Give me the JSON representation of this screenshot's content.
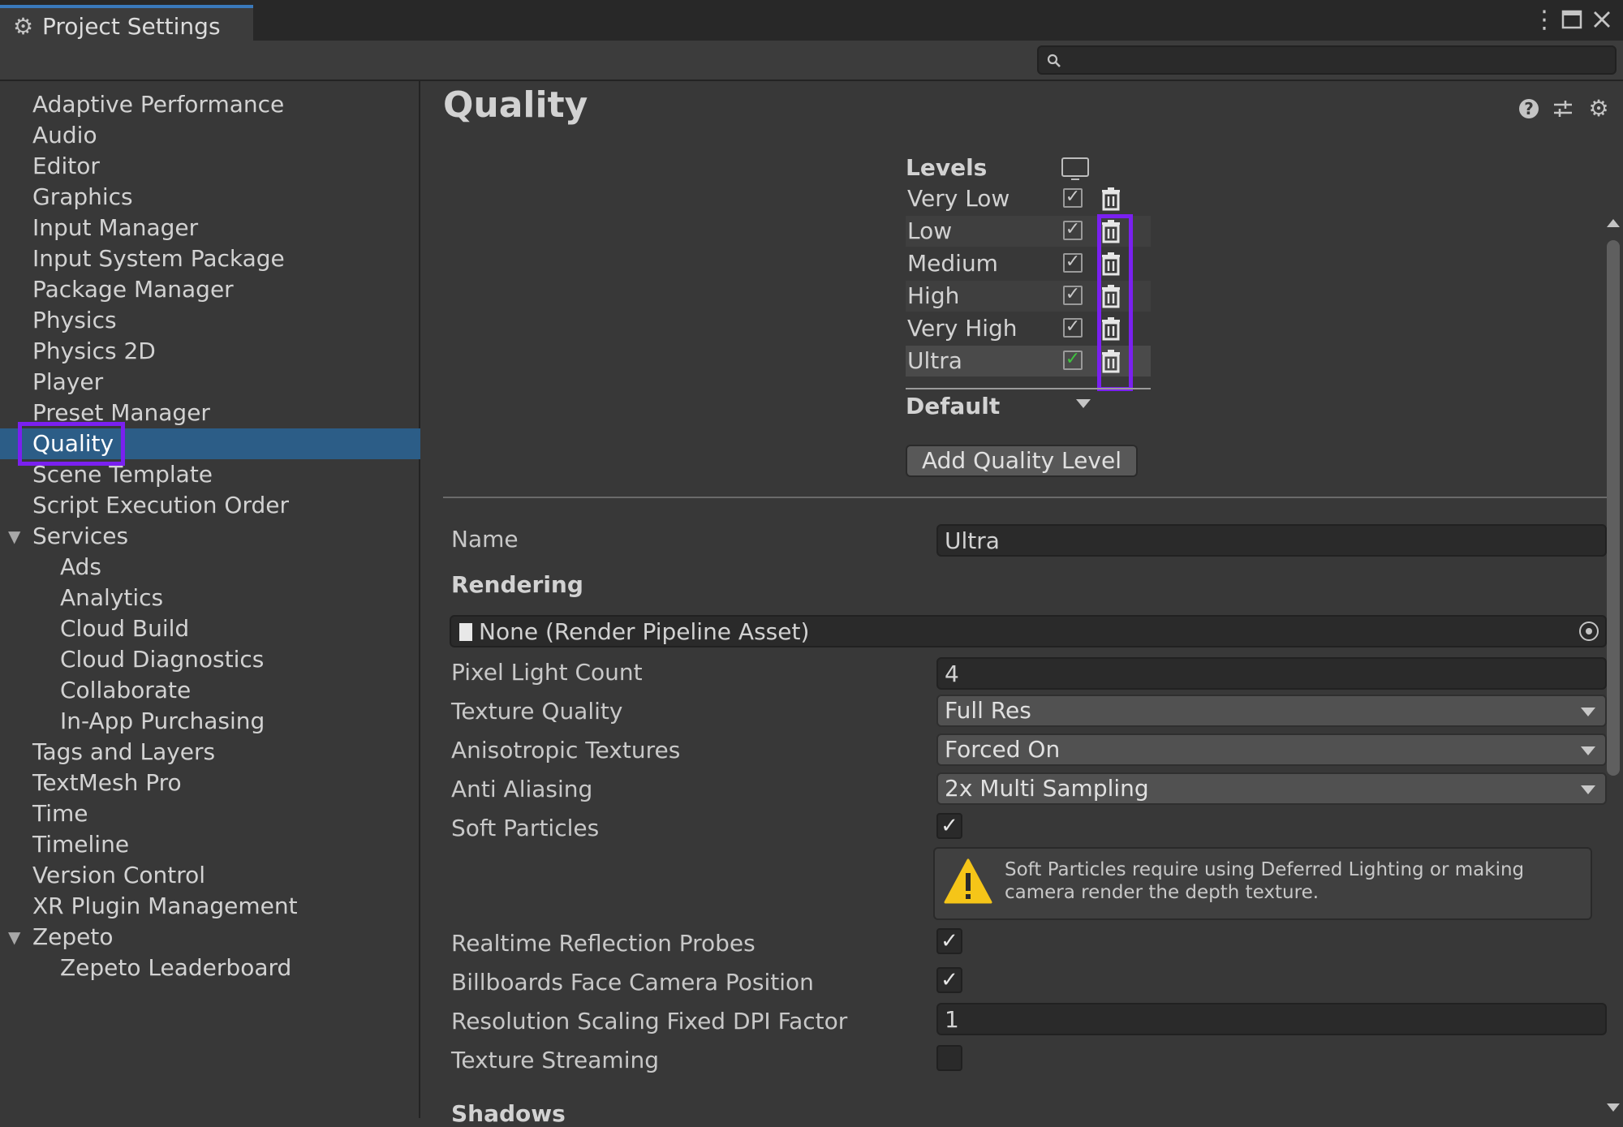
{
  "window": {
    "tab_title": "Project Settings",
    "gear_icon": "gear-icon",
    "controls": [
      "more-icon",
      "maximize-icon",
      "close-icon"
    ]
  },
  "search": {
    "placeholder": "",
    "value": ""
  },
  "sidebar": {
    "items": [
      {
        "label": "Adaptive Performance"
      },
      {
        "label": "Audio"
      },
      {
        "label": "Editor"
      },
      {
        "label": "Graphics"
      },
      {
        "label": "Input Manager"
      },
      {
        "label": "Input System Package"
      },
      {
        "label": "Package Manager"
      },
      {
        "label": "Physics"
      },
      {
        "label": "Physics 2D"
      },
      {
        "label": "Player"
      },
      {
        "label": "Preset Manager"
      },
      {
        "label": "Quality",
        "selected": true
      },
      {
        "label": "Scene Template"
      },
      {
        "label": "Script Execution Order"
      },
      {
        "label": "Services",
        "expanded": true
      },
      {
        "label": "Ads"
      },
      {
        "label": "Analytics"
      },
      {
        "label": "Cloud Build"
      },
      {
        "label": "Cloud Diagnostics"
      },
      {
        "label": "Collaborate"
      },
      {
        "label": "In-App Purchasing"
      },
      {
        "label": "Tags and Layers"
      },
      {
        "label": "TextMesh Pro"
      },
      {
        "label": "Time"
      },
      {
        "label": "Timeline"
      },
      {
        "label": "Version Control"
      },
      {
        "label": "XR Plugin Management"
      },
      {
        "label": "Zepeto",
        "expanded": true
      },
      {
        "label": "Zepeto Leaderboard"
      }
    ]
  },
  "main": {
    "title": "Quality",
    "levels": {
      "header": "Levels",
      "rows": [
        {
          "name": "Very Low",
          "enabled": true
        },
        {
          "name": "Low",
          "enabled": true
        },
        {
          "name": "Medium",
          "enabled": true
        },
        {
          "name": "High",
          "enabled": true
        },
        {
          "name": "Very High",
          "enabled": true
        },
        {
          "name": "Ultra",
          "enabled": true,
          "selected": true
        }
      ],
      "default_label": "Default",
      "add_button": "Add Quality Level"
    },
    "name_label": "Name",
    "name_value": "Ultra",
    "rendering": {
      "header": "Rendering",
      "pipeline_asset": "None (Render Pipeline Asset)",
      "pixel_light_count_label": "Pixel Light Count",
      "pixel_light_count": "4",
      "texture_quality_label": "Texture Quality",
      "texture_quality": "Full Res",
      "anisotropic_label": "Anisotropic Textures",
      "anisotropic": "Forced On",
      "anti_aliasing_label": "Anti Aliasing",
      "anti_aliasing": "2x Multi Sampling",
      "soft_particles_label": "Soft Particles",
      "soft_particles": true,
      "warning": "Soft Particles require using Deferred Lighting or making camera render the depth texture.",
      "realtime_reflection_label": "Realtime Reflection Probes",
      "realtime_reflection": true,
      "billboards_label": "Billboards Face Camera Position",
      "billboards": true,
      "dpi_factor_label": "Resolution Scaling Fixed DPI Factor",
      "dpi_factor": "1",
      "texture_streaming_label": "Texture Streaming",
      "texture_streaming": false
    },
    "shadows_header": "Shadows"
  },
  "colors": {
    "accent": "#3a79bb",
    "selection": "#2c5d87",
    "highlight": "#7a20f0",
    "warning": "#f5c518"
  }
}
